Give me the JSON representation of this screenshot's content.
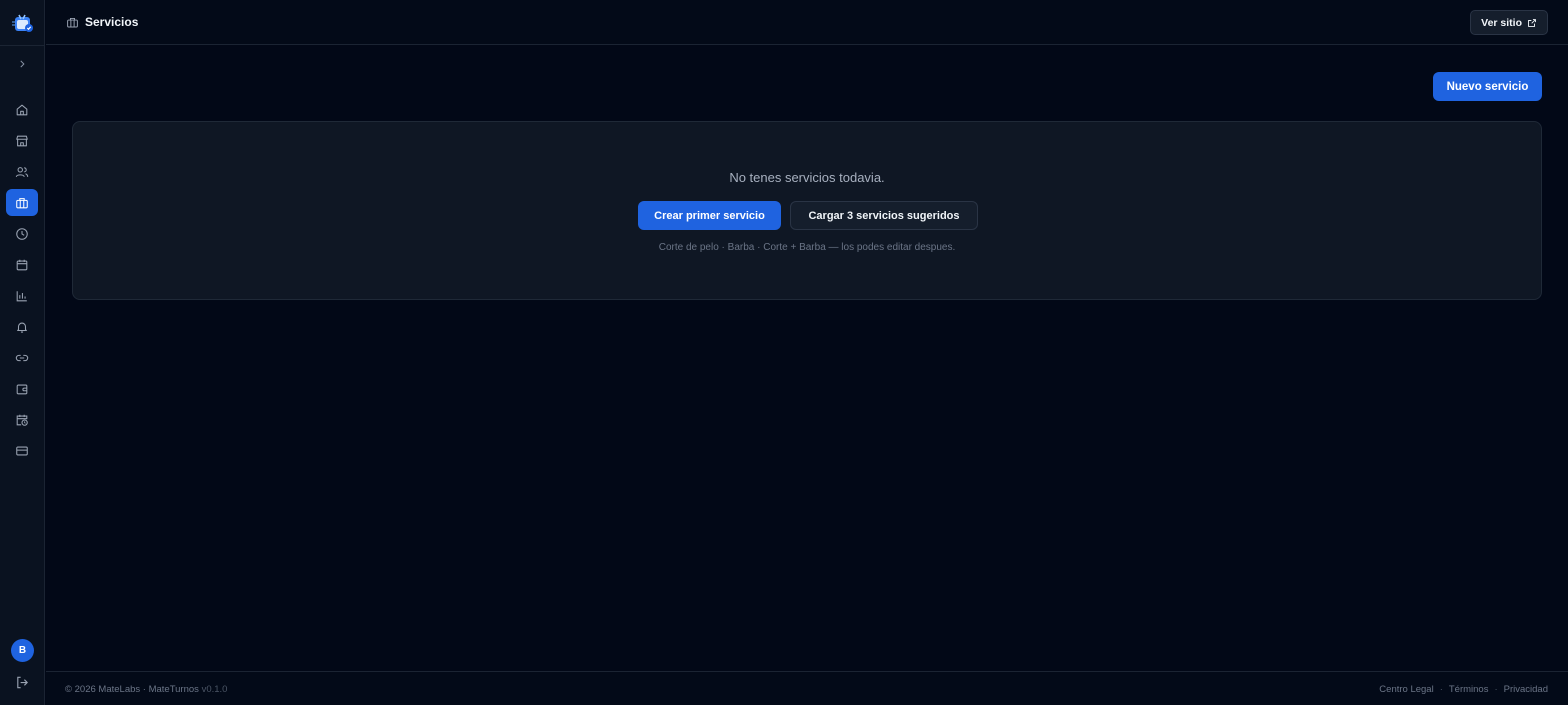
{
  "header": {
    "title": "Servicios",
    "ver_sitio_label": "Ver sitio"
  },
  "sidebar": {
    "items": [
      {
        "icon": "home-icon",
        "active": false
      },
      {
        "icon": "store-icon",
        "active": false
      },
      {
        "icon": "users-icon",
        "active": false
      },
      {
        "icon": "briefcase-icon",
        "active": true
      },
      {
        "icon": "clock-icon",
        "active": false
      },
      {
        "icon": "calendar-icon",
        "active": false
      },
      {
        "icon": "bar-chart-icon",
        "active": false
      },
      {
        "icon": "bell-icon",
        "active": false
      },
      {
        "icon": "link-icon",
        "active": false
      },
      {
        "icon": "wallet-icon",
        "active": false
      },
      {
        "icon": "calendar-clock-icon",
        "active": false
      },
      {
        "icon": "credit-card-icon",
        "active": false
      }
    ],
    "avatar_initial": "B"
  },
  "main": {
    "new_service_label": "Nuevo servicio",
    "empty_message": "No tenes servicios todavia.",
    "create_first_label": "Crear primer servicio",
    "load_suggested_label": "Cargar 3 servicios sugeridos",
    "hint": "Corte de pelo · Barba · Corte + Barba — los podes editar despues."
  },
  "footer": {
    "copyright": "© 2026 MateLabs · MateTurnos",
    "version": "v0.1.0",
    "links": [
      "Centro Legal",
      "Términos",
      "Privacidad"
    ],
    "separator": "·"
  },
  "colors": {
    "accent": "#1f63e0",
    "background": "#020817",
    "card": "#0f1724"
  }
}
